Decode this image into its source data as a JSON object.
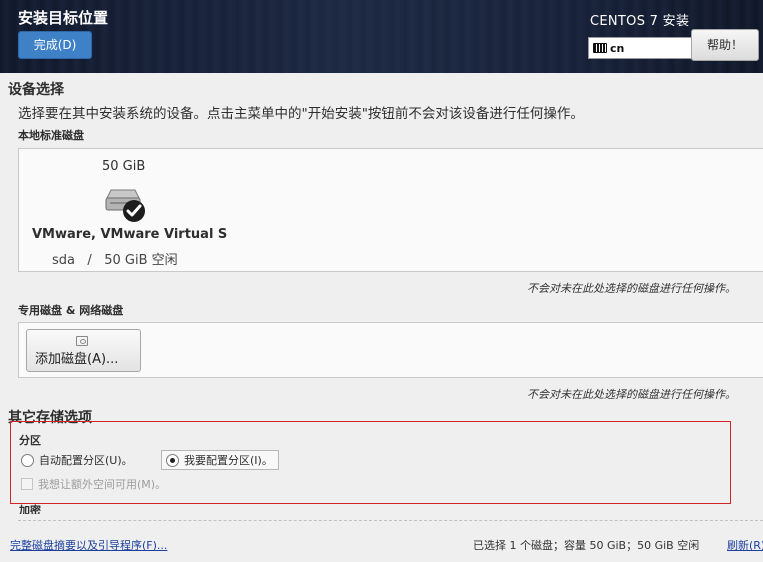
{
  "header": {
    "page_title": "安装目标位置",
    "done_button": "完成(D)",
    "product_title": "CENTOS 7 安装",
    "keyboard_layout": "cn",
    "help_button": "帮助！"
  },
  "device_selection": {
    "title": "设备选择",
    "description": "选择要在其中安装系统的设备。点击主菜单中的\"开始安装\"按钮前不会对该设备进行任何操作。",
    "local_disks_label": "本地标准磁盘",
    "disk": {
      "size": "50 GiB",
      "name": "VMware, VMware Virtual S",
      "device": "sda",
      "separator": "/",
      "free": "50 GiB 空闲",
      "selected": true
    },
    "local_note": "不会对未在此处选择的磁盘进行任何操作。",
    "special_label": "专用磁盘 & 网络磁盘",
    "add_disk_button": "添加磁盘(A)...",
    "special_note": "不会对未在此处选择的磁盘进行任何操作。"
  },
  "other_storage": {
    "title": "其它存储选项",
    "partition_label": "分区",
    "auto_partition": "自动配置分区(U)。",
    "manual_partition": "我要配置分区(I)。",
    "selected_partition": "manual",
    "extra_space": "我想让额外空间可用(M)。",
    "encryption_label": "加密"
  },
  "footer": {
    "summary_link": "完整磁盘摘要以及引导程序(F)...",
    "status": "已选择 1 个磁盘；容量 50 GiB；50 GiB 空闲",
    "refresh_link": "刷新(R)"
  },
  "colors": {
    "header_bg": "#141c2c",
    "primary_button": "#3f81c6",
    "highlight_border": "#d12424",
    "link": "#1c3f9e"
  }
}
